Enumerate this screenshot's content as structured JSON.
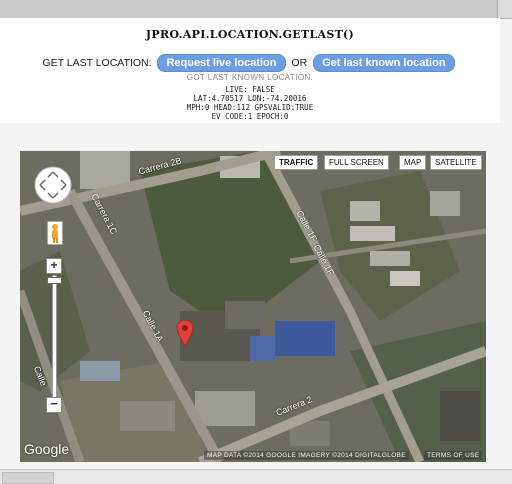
{
  "title": "JPRO.API.LOCATION.GETLAST()",
  "controls": {
    "label": "GET LAST LOCATION:",
    "live_button": "Request live location",
    "or_label": "OR",
    "known_button": "Get last known location"
  },
  "status_caption": "GOT LAST KNOWN LOCATION.",
  "result_lines": [
    "LIVE: FALSE",
    "LAT:4.70517 LON:-74.20016",
    "MPH:0 HEAD:112 GPSVALID:TRUE",
    "EV CODE:1 EPOCH:0"
  ],
  "map": {
    "buttons": {
      "traffic": "TRAFFIC",
      "fullscreen": "FULL SCREEN",
      "map": "MAP",
      "satellite": "SATELLITE"
    },
    "street_labels": {
      "carrera_2b": "Carrera 2B",
      "carrera_1c": "Carrera 1C",
      "calle_1f": "Calle 1F",
      "calle_1f_2": "Calle 1F",
      "calle_1a": "Calle 1A",
      "calle": "Calle",
      "carrera_2": "Carrera 2"
    },
    "google_logo": "Google",
    "attribution": "MAP DATA ©2014 GOOGLE IMAGERY ©2014 DIGITALGLOBE",
    "terms": "TERMS OF USE",
    "colors": {
      "marker": "#e0413a",
      "roads": "#9c978a",
      "water_roof": "#3e5a9c"
    }
  }
}
